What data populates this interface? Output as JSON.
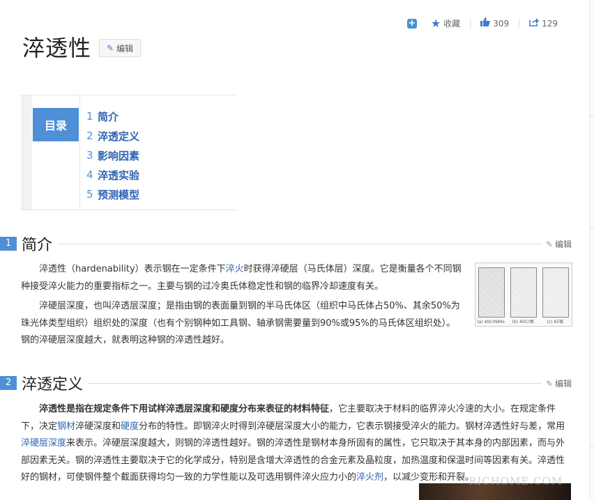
{
  "actions": {
    "favorite_label": "收藏",
    "like_count": "309",
    "share_count": "129"
  },
  "title": "淬透性",
  "edit_label": "编辑",
  "toc": {
    "label": "目录",
    "items": [
      {
        "num": "1",
        "text": "简介"
      },
      {
        "num": "2",
        "text": "淬透定义"
      },
      {
        "num": "3",
        "text": "影响因素"
      },
      {
        "num": "4",
        "text": "淬透实验"
      },
      {
        "num": "5",
        "text": "预测模型"
      }
    ]
  },
  "section1": {
    "num": "1",
    "title": "简介",
    "edit": "编辑",
    "p1_a": "淬透性（hardenability）表示钢在一定条件下",
    "p1_link": "淬火",
    "p1_b": "时获得淬硬层（马氏体层）深度。它是衡量各个不同钢种接受淬火能力的重要指标之一。主要与钢的过冷奥氏体稳定性和钢的临界冷却速度有关。",
    "p2": "淬硬层深度，也叫淬透层深度；是指由钢的表面量到钢的半马氏体区（组织中马氏体占50%、其余50%为珠光体类型组织）组织处的深度（也有个别钢种如工具钢、轴承钢需要量到90%或95%的马氏体区组织处）。钢的淬硬层深度越大，就表明这种钢的淬透性越好。"
  },
  "section2": {
    "num": "2",
    "title": "淬透定义",
    "edit": "编辑",
    "p_bold": "淬透性是指在规定条件下用试样淬透层深度和硬度分布来表征的材料特征",
    "p_a": "，它主要取决于材料的临界淬火冷速的大小。在规定条件下，决定",
    "link1": "钢材",
    "p_b": "淬硬深度和",
    "link2": "硬度",
    "p_c": "分布的特性。即钢淬火时得到淬硬层深度大小的能力，它表示钢接受淬火的能力。钢材淬透性好与差，常用",
    "link3": "淬硬层深度",
    "p_d": "来表示。淬硬层深度越大，则钢的淬透性越好。钢的淬透性是钢材本身所固有的属性，它只取决于其本身的内部因素，而与外部因素无关。钢的淬透性主要取决于它的化学成分，特别是含增大淬透性的合金元素及晶粒度，加热温度和保温时间等因素有关。淬透性好的钢材，可使钢件整个截面获得均匀一致的力学性能以及可选用钢件淬火应力小的",
    "link4": "淬火剂",
    "p_e": "，以减少变形和开裂。"
  },
  "figure_captions": [
    "(a) 40CrNiMo",
    "(b) 40Cr钢",
    "(c) 45钢"
  ],
  "watermark": "RICHOME.COM"
}
